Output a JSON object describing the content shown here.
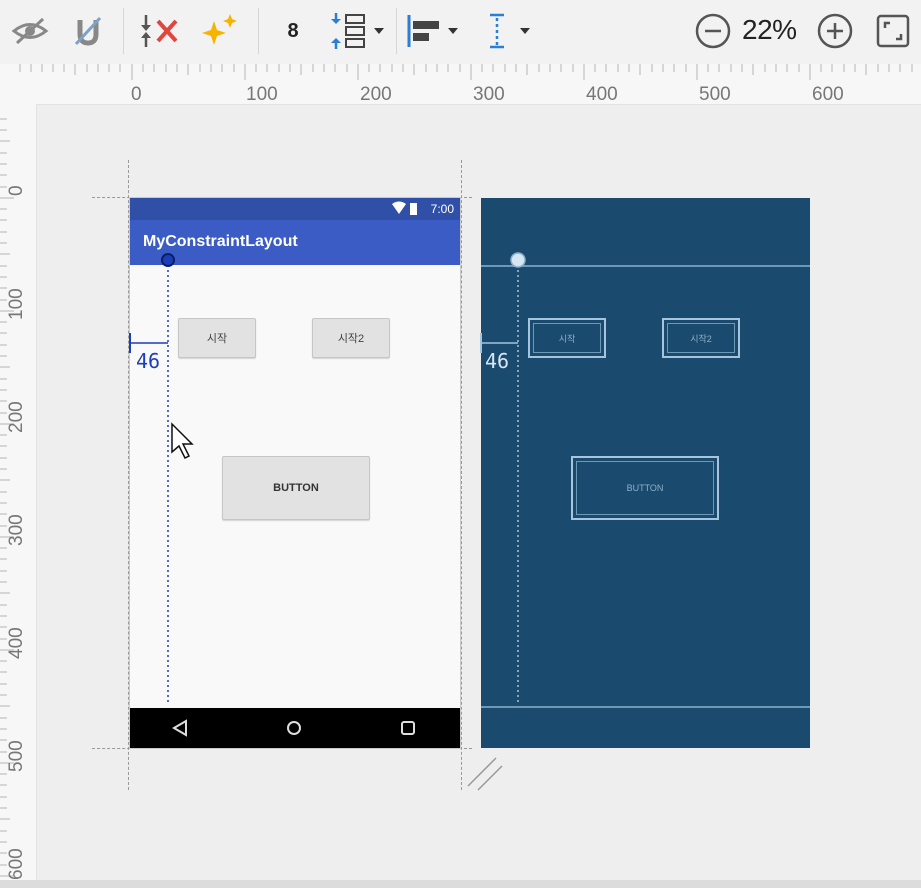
{
  "toolbar": {
    "items": [
      {
        "name": "show-hide-eye-icon"
      },
      {
        "name": "magnet-autoconnect-icon"
      },
      {
        "name": "clear-constraints-icon"
      },
      {
        "name": "infer-constraints-sparkle-icon"
      },
      {
        "name": "default-margin",
        "label": "8"
      },
      {
        "name": "pack-icon"
      },
      {
        "name": "align-icon"
      },
      {
        "name": "guidelines-icon"
      }
    ],
    "zoom_value": "22%",
    "zoom_out_icon": "minus-circle-icon",
    "zoom_in_icon": "plus-circle-icon",
    "fit_icon": "fit-screen-icon"
  },
  "rulers": {
    "top_labels": [
      "0",
      "100",
      "200",
      "300",
      "400",
      "500",
      "600"
    ],
    "left_labels": [
      "0",
      "100",
      "200",
      "300",
      "400",
      "500",
      "600"
    ]
  },
  "design": {
    "status_time": "7:00",
    "app_title": "MyConstraintLayout",
    "button1": "시작",
    "button2": "시작2",
    "button3": "BUTTON",
    "margin_label": "46",
    "nav_icons": [
      "back-triangle-icon",
      "home-circle-icon",
      "recents-square-icon"
    ]
  },
  "blueprint": {
    "margin_label": "46",
    "button1": "시작",
    "button2": "시작2",
    "button3": "BUTTON"
  },
  "colors": {
    "statusbar": "#2f50a6",
    "appbar": "#3a5cc4",
    "blueprint_bg": "#1a4a6e",
    "constraint_blue": "#1b3fb8"
  }
}
